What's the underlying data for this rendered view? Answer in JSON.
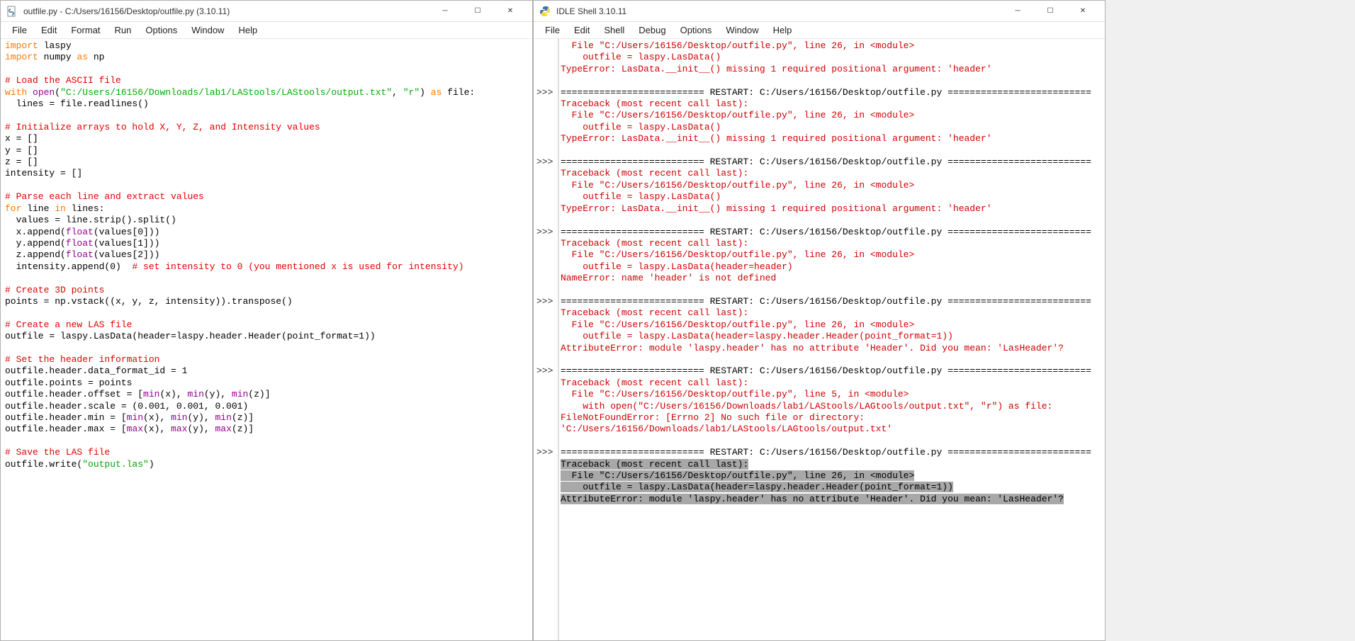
{
  "editor_window": {
    "title": "outfile.py - C:/Users/16156/Desktop/outfile.py (3.10.11)",
    "menus": [
      "File",
      "Edit",
      "Format",
      "Run",
      "Options",
      "Window",
      "Help"
    ]
  },
  "shell_window": {
    "title": "IDLE Shell 3.10.11",
    "menus": [
      "File",
      "Edit",
      "Shell",
      "Debug",
      "Options",
      "Window",
      "Help"
    ]
  },
  "code": {
    "l1a": "import",
    "l1b": " laspy",
    "l2a": "import",
    "l2b": " numpy ",
    "l2c": "as",
    "l2d": " np",
    "l4": "# Load the ASCII file",
    "l5a": "with",
    "l5b": " ",
    "l5c": "open",
    "l5d": "(",
    "l5e": "\"C:/Users/16156/Downloads/lab1/LAStools/LAStools/output.txt\"",
    "l5f": ", ",
    "l5g": "\"r\"",
    "l5h": ") ",
    "l5i": "as",
    "l5j": " file:",
    "l6": "  lines = file.readlines()",
    "l8": "# Initialize arrays to hold X, Y, Z, and Intensity values",
    "l9": "x = []",
    "l10": "y = []",
    "l11": "z = []",
    "l12": "intensity = []",
    "l14": "# Parse each line and extract values",
    "l15a": "for",
    "l15b": " line ",
    "l15c": "in",
    "l15d": " lines:",
    "l16": "  values = line.strip().split()",
    "l17a": "  x.append(",
    "l17b": "float",
    "l17c": "(values[0]))",
    "l18a": "  y.append(",
    "l18b": "float",
    "l18c": "(values[1]))",
    "l19a": "  z.append(",
    "l19b": "float",
    "l19c": "(values[2]))",
    "l20a": "  intensity.append(0)  ",
    "l20b": "# set intensity to 0 (you mentioned x is used for intensity)",
    "l22": "# Create 3D points",
    "l23": "points = np.vstack((x, y, z, intensity)).transpose()",
    "l25": "# Create a new LAS file",
    "l26": "outfile = laspy.LasData(header=laspy.header.Header(point_format=1))",
    "l28": "# Set the header information",
    "l29": "outfile.header.data_format_id = 1",
    "l30": "outfile.points = points",
    "l31a": "outfile.header.offset = [",
    "l31b": "min",
    "l31c": "(x), ",
    "l31d": "min",
    "l31e": "(y), ",
    "l31f": "min",
    "l31g": "(z)]",
    "l32": "outfile.header.scale = (0.001, 0.001, 0.001)",
    "l33a": "outfile.header.min = [",
    "l33b": "min",
    "l33c": "(x), ",
    "l33d": "min",
    "l33e": "(y), ",
    "l33f": "min",
    "l33g": "(z)]",
    "l34a": "outfile.header.max = [",
    "l34b": "max",
    "l34c": "(x), ",
    "l34d": "max",
    "l34e": "(y), ",
    "l34f": "max",
    "l34g": "(z)]",
    "l36": "# Save the LAS file",
    "l37a": "outfile.write(",
    "l37b": "\"output.las\"",
    "l37c": ")"
  },
  "shell": {
    "s1": "  File \"C:/Users/16156/Desktop/outfile.py\", line 26, in <module>",
    "s2": "    outfile = laspy.LasData()",
    "s3": "TypeError: LasData.__init__() missing 1 required positional argument: 'header'",
    "restart": "========================== RESTART: C:/Users/16156/Desktop/outfile.py ==========================",
    "tb": "Traceback (most recent call last):",
    "s4": "    outfile = laspy.LasData(header=header)",
    "nameerr": "NameError: name 'header' is not defined",
    "s5": "    outfile = laspy.LasData(header=laspy.header.Header(point_format=1))",
    "attrerr": "AttributeError: module 'laspy.header' has no attribute 'Header'. Did you mean: 'LasHeader'?",
    "s6": "  File \"C:/Users/16156/Desktop/outfile.py\", line 5, in <module>",
    "s7": "    with open(\"C:/Users/16156/Downloads/lab1/LAStools/LAGtools/output.txt\", \"r\") as file:",
    "fnferr": "FileNotFoundError: [Errno 2] No such file or directory: 'C:/Users/16156/Downloads/lab1/LAStools/LAGtools/output.txt'",
    "prompts": ">>>"
  }
}
